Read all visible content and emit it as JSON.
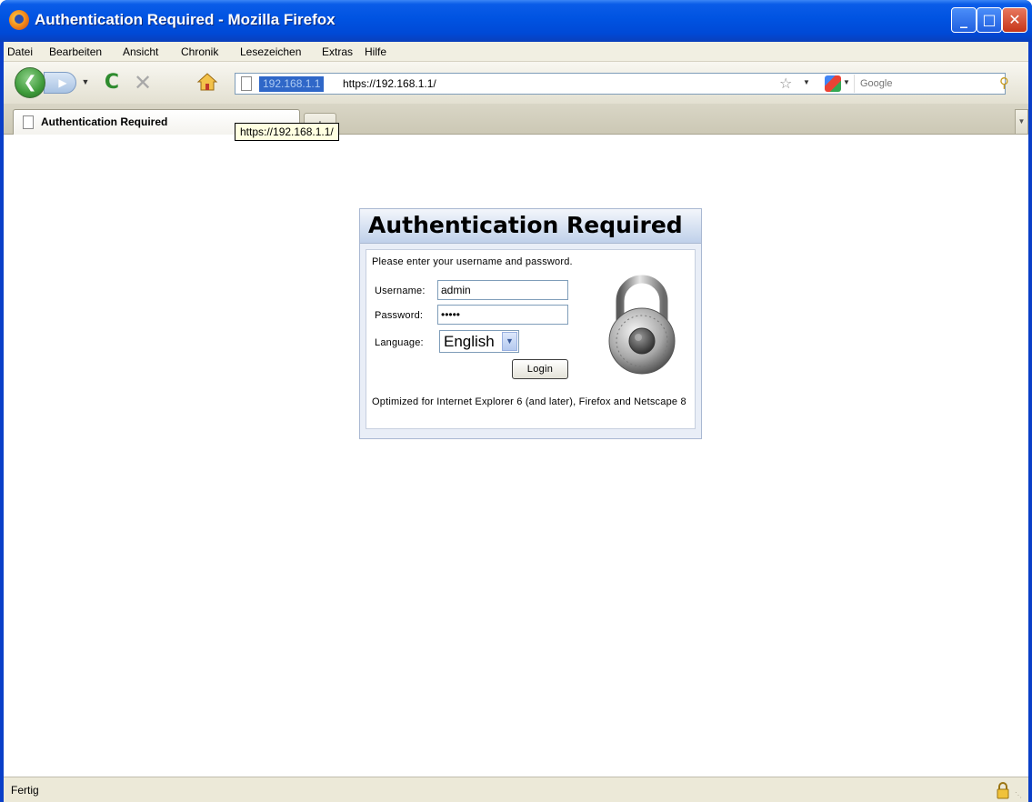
{
  "window": {
    "title": "Authentication Required - Mozilla Firefox",
    "controls": {
      "minimize": "_",
      "maximize": "□",
      "close": "✕"
    }
  },
  "menubar": {
    "items": [
      "Datei",
      "Bearbeiten",
      "Ansicht",
      "Chronik",
      "Lesezeichen",
      "Extras",
      "Hilfe"
    ]
  },
  "navbar": {
    "back_icon": "back-arrow-icon",
    "forward_icon": "forward-arrow-icon",
    "identity_label": "192.168.1.1",
    "url": "https://192.168.1.1/",
    "search_placeholder": "Google"
  },
  "tabs": {
    "active_label": "Authentication Required",
    "new_tab_label": "+"
  },
  "tooltip": {
    "text": "https://192.168.1.1/"
  },
  "auth": {
    "title": "Authentication Required",
    "intro": "Please enter your username and password.",
    "username_label": "Username:",
    "username_value": "admin",
    "password_label": "Password:",
    "password_value": "admin",
    "language_label": "Language:",
    "language_value": "English",
    "login_label": "Login",
    "footer_note": "Optimized for Internet Explorer 6 (and later), Firefox and Netscape 8"
  },
  "statusbar": {
    "text": "Fertig"
  },
  "colors": {
    "titlebar": "#0053e1",
    "auth_header": "#bfd0ea",
    "identity_bg": "#2f67c8"
  }
}
